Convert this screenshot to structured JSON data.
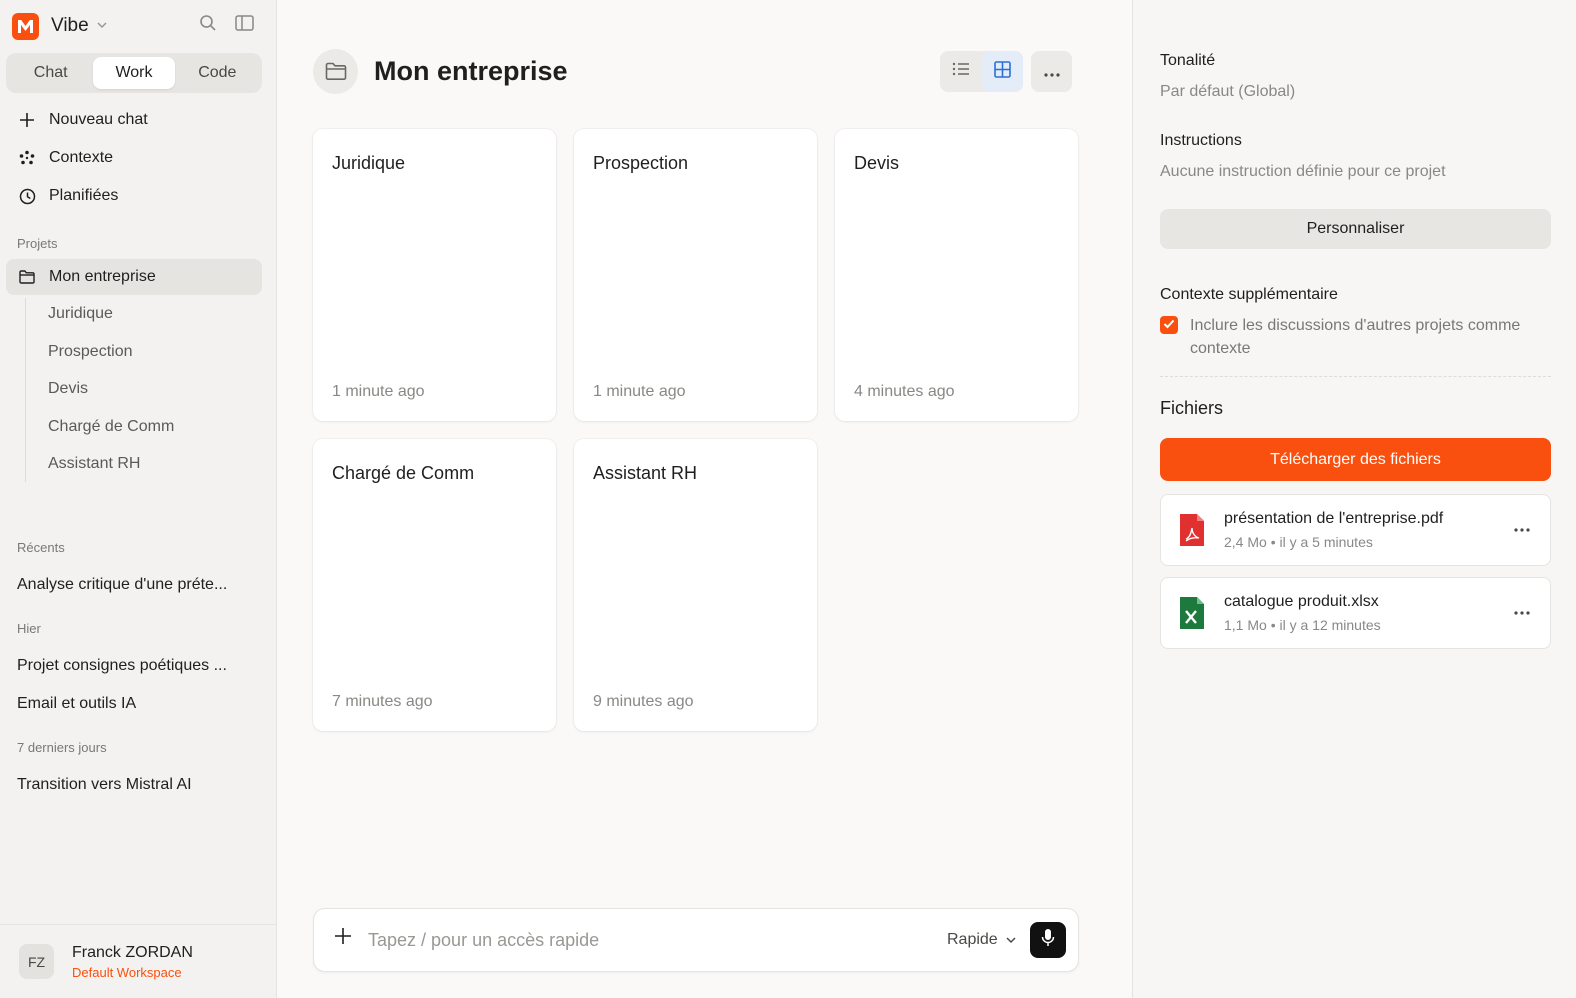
{
  "brand": {
    "name": "Vibe",
    "color": "#fa500f"
  },
  "modes": [
    {
      "label": "Chat",
      "active": false
    },
    {
      "label": "Work",
      "active": true
    },
    {
      "label": "Code",
      "active": false
    }
  ],
  "nav": {
    "new_chat": "Nouveau chat",
    "context": "Contexte",
    "scheduled": "Planifiées"
  },
  "projects": {
    "section_label": "Projets",
    "active": "Mon entreprise",
    "children": [
      "Juridique",
      "Prospection",
      "Devis",
      "Chargé de Comm",
      "Assistant RH"
    ]
  },
  "recents": {
    "label": "Récents",
    "items": [
      "Analyse critique d'une préte..."
    ],
    "yesterday_label": "Hier",
    "yesterday_items": [
      "Projet consignes poétiques ...",
      "Email et outils IA"
    ],
    "week_label": "7 derniers jours",
    "week_items": [
      "Transition vers Mistral AI"
    ]
  },
  "user": {
    "initials": "FZ",
    "name": "Franck ZORDAN",
    "workspace": "Default Workspace"
  },
  "main": {
    "title": "Mon entreprise",
    "cards": [
      {
        "title": "Juridique",
        "time": "1 minute ago"
      },
      {
        "title": "Prospection",
        "time": "1 minute ago"
      },
      {
        "title": "Devis",
        "time": "4 minutes ago"
      },
      {
        "title": "Chargé de Comm",
        "time": "7 minutes ago"
      },
      {
        "title": "Assistant RH",
        "time": "9 minutes ago"
      }
    ],
    "composer": {
      "placeholder": "Tapez / pour un accès rapide",
      "mode": "Rapide"
    }
  },
  "panel": {
    "tone_label": "Tonalité",
    "tone_value": "Par défaut (Global)",
    "instructions_label": "Instructions",
    "instructions_value": "Aucune instruction définie pour ce projet",
    "customize": "Personnaliser",
    "extra_context_label": "Contexte supplémentaire",
    "extra_context_checked": true,
    "extra_context_text": "Inclure les discussions d'autres projets comme contexte",
    "files_title": "Fichiers",
    "upload": "Télécharger des fichiers",
    "files": [
      {
        "name": "présentation de l'entreprise.pdf",
        "meta": "2,4 Mo • il y a 5 minutes",
        "icon": "pdf-icon"
      },
      {
        "name": "catalogue produit.xlsx",
        "meta": "1,1 Mo • il y a 12 minutes",
        "icon": "excel-icon"
      }
    ]
  }
}
